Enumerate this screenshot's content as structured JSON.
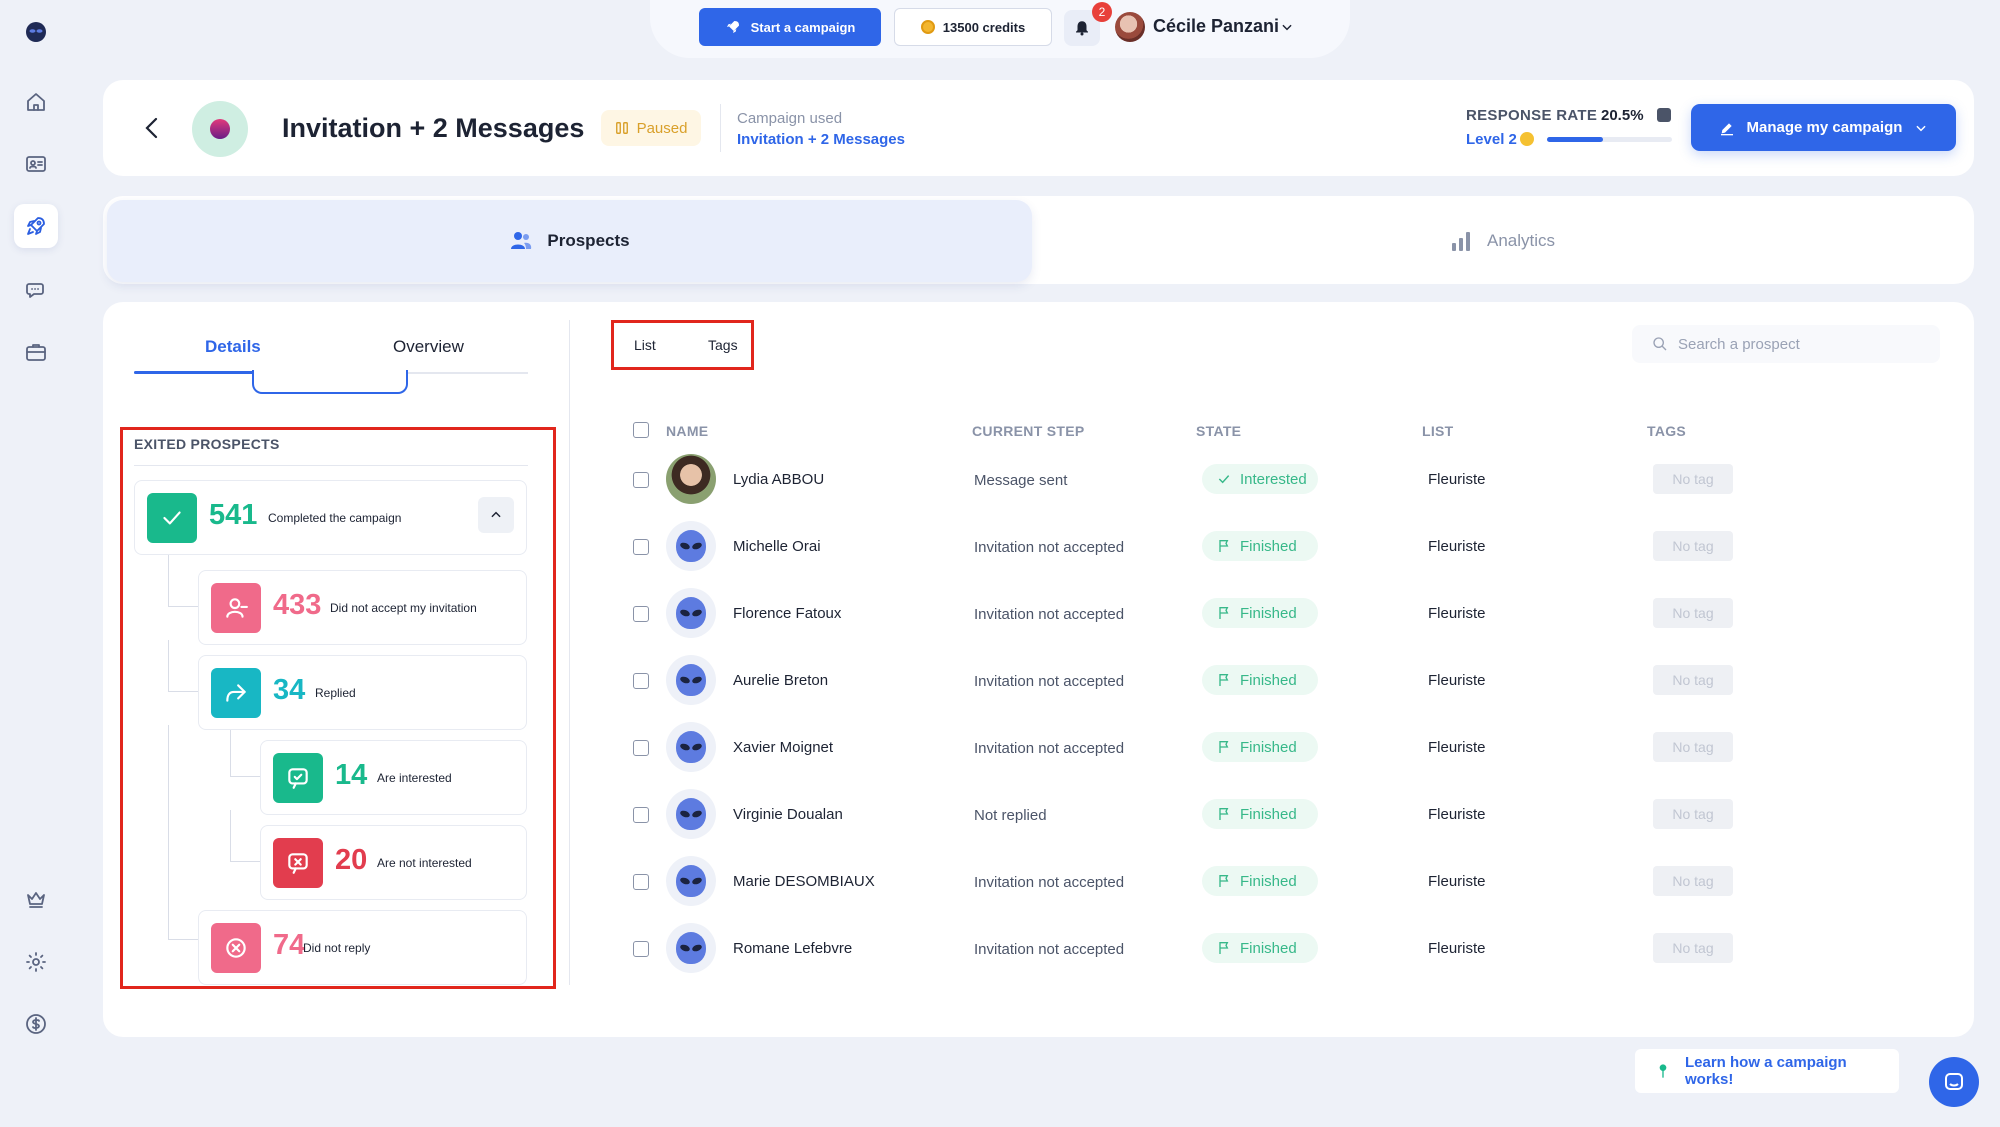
{
  "topbar": {
    "start_campaign": "Start a campaign",
    "credits": "13500 credits",
    "notifications_count": "2",
    "user_name": "Cécile Panzani"
  },
  "campaign": {
    "title": "Invitation + 2 Messages",
    "status": "Paused",
    "used_label": "Campaign used",
    "used_name": "Invitation + 2 Messages",
    "response_rate_label": "RESPONSE RATE",
    "response_rate_value": "20.5%",
    "level": "Level 2",
    "level_progress": 0.45,
    "manage_button": "Manage my campaign"
  },
  "tabs": {
    "prospects": "Prospects",
    "analytics": "Analytics"
  },
  "left_panel": {
    "tabs": {
      "details": "Details",
      "overview": "Overview"
    },
    "exited_title": "EXITED PROSPECTS",
    "stats": {
      "completed": {
        "value": "541",
        "label": "Completed the campaign"
      },
      "not_accepted": {
        "value": "433",
        "label": "Did not accept my invitation"
      },
      "replied": {
        "value": "34",
        "label": "Replied"
      },
      "interested": {
        "value": "14",
        "label": "Are interested"
      },
      "not_interested": {
        "value": "20",
        "label": "Are not interested"
      },
      "no_reply": {
        "value": "74",
        "label": "Did not reply"
      }
    }
  },
  "list_panel": {
    "segments": {
      "list": "List",
      "tags": "Tags"
    },
    "search_placeholder": "Search a prospect",
    "columns": {
      "name": "NAME",
      "current_step": "CURRENT STEP",
      "state": "STATE",
      "list": "LIST",
      "tags": "TAGS"
    },
    "rows": [
      {
        "name": "Lydia ABBOU",
        "step": "Message sent",
        "state": "Interested",
        "list": "Fleuriste",
        "tag": "No tag",
        "avatar": "photo"
      },
      {
        "name": "Michelle Orai",
        "step": "Invitation not accepted",
        "state": "Finished",
        "list": "Fleuriste",
        "tag": "No tag",
        "avatar": "alien"
      },
      {
        "name": "Florence Fatoux",
        "step": "Invitation not accepted",
        "state": "Finished",
        "list": "Fleuriste",
        "tag": "No tag",
        "avatar": "alien"
      },
      {
        "name": "Aurelie Breton",
        "step": "Invitation not accepted",
        "state": "Finished",
        "list": "Fleuriste",
        "tag": "No tag",
        "avatar": "alien"
      },
      {
        "name": "Xavier Moignet",
        "step": "Invitation not accepted",
        "state": "Finished",
        "list": "Fleuriste",
        "tag": "No tag",
        "avatar": "alien"
      },
      {
        "name": "Virginie Doualan",
        "step": "Not replied",
        "state": "Finished",
        "list": "Fleuriste",
        "tag": "No tag",
        "avatar": "alien"
      },
      {
        "name": "Marie DESOMBIAUX",
        "step": "Invitation not accepted",
        "state": "Finished",
        "list": "Fleuriste",
        "tag": "No tag",
        "avatar": "alien"
      },
      {
        "name": "Romane Lefebvre",
        "step": "Invitation not accepted",
        "state": "Finished",
        "list": "Fleuriste",
        "tag": "No tag",
        "avatar": "alien"
      }
    ]
  },
  "footer": {
    "learn_link": "Learn how a campaign works!"
  },
  "colors": {
    "accent": "#2f66e8",
    "green": "#19b98c",
    "pink": "#f06a8a",
    "teal": "#18b7c4",
    "red": "#e23d4e",
    "highlight": "#e1261c"
  }
}
